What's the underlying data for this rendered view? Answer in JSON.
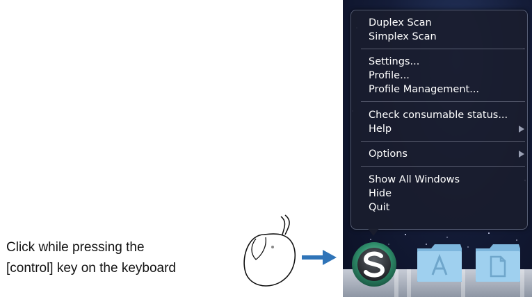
{
  "instruction": {
    "line1": "Click while pressing the",
    "line2": "[control] key on the keyboard"
  },
  "context_menu": {
    "groups": [
      {
        "items": [
          {
            "label": "Duplex Scan"
          },
          {
            "label": "Simplex Scan"
          }
        ]
      },
      {
        "items": [
          {
            "label": "Settings..."
          },
          {
            "label": "Profile..."
          },
          {
            "label": "Profile Management..."
          }
        ]
      },
      {
        "items": [
          {
            "label": "Check consumable status..."
          },
          {
            "label": "Help",
            "submenu": true
          }
        ]
      },
      {
        "items": [
          {
            "label": "Options",
            "submenu": true
          }
        ]
      },
      {
        "items": [
          {
            "label": "Show All Windows"
          },
          {
            "label": "Hide"
          },
          {
            "label": "Quit"
          }
        ]
      }
    ]
  },
  "dock": {
    "items": [
      {
        "icon": "scansnap-manager-icon"
      },
      {
        "icon": "applications-folder-icon"
      },
      {
        "icon": "documents-folder-icon"
      }
    ]
  },
  "colors": {
    "arrow": "#2f74b8",
    "menu_text": "#ffffff",
    "scansnap_ring": "#2e8c6a",
    "folder": "#8ec3e6"
  }
}
